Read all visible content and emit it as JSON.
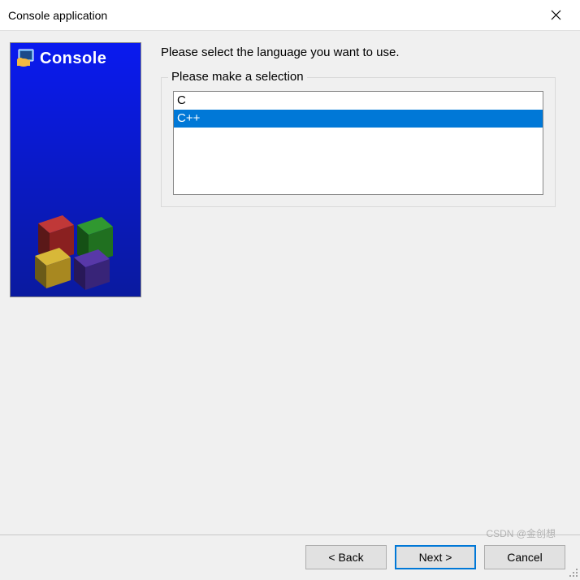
{
  "window": {
    "title": "Console application"
  },
  "sidebar": {
    "title": "Console"
  },
  "main": {
    "instruction": "Please select the language you want to use.",
    "group_label": "Please make a selection",
    "options": [
      {
        "label": "C",
        "selected": false
      },
      {
        "label": "C++",
        "selected": true
      }
    ]
  },
  "buttons": {
    "back": "< Back",
    "next": "Next >",
    "cancel": "Cancel"
  },
  "watermark": "CSDN @金创想"
}
